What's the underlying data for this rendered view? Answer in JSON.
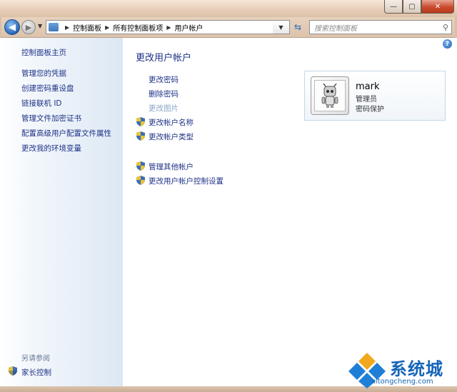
{
  "window": {
    "minimize_glyph": "—",
    "maximize_glyph": "▢",
    "close_glyph": "✕"
  },
  "nav": {
    "breadcrumbs": [
      "控制面板",
      "所有控制面板项",
      "用户帐户"
    ],
    "search_placeholder": "搜索控制面板"
  },
  "sidebar": {
    "items": [
      {
        "label": "控制面板主页"
      },
      {
        "label": "管理您的凭据"
      },
      {
        "label": "创建密码重设盘"
      },
      {
        "label": "链接联机 ID"
      },
      {
        "label": "管理文件加密证书"
      },
      {
        "label": "配置高级用户配置文件属性"
      },
      {
        "label": "更改我的环境变量"
      }
    ],
    "see_also": "另请参阅",
    "parental_controls": "家长控制"
  },
  "main": {
    "heading": "更改用户帐户",
    "tasks": [
      {
        "label": "更改密码"
      },
      {
        "label": "删除密码"
      },
      {
        "label": "更改图片"
      },
      {
        "label": "更改帐户名称"
      },
      {
        "label": "更改帐户类型"
      },
      {
        "label": "管理其他帐户"
      },
      {
        "label": "更改用户帐户控制设置"
      }
    ]
  },
  "user": {
    "name": "mark",
    "role": "管理员",
    "password_status": "密码保护"
  },
  "watermark": {
    "brand": "系统城",
    "url": "xitongcheng.com"
  },
  "colors": {
    "link": "#1e3287",
    "accent": "#1565b8"
  }
}
